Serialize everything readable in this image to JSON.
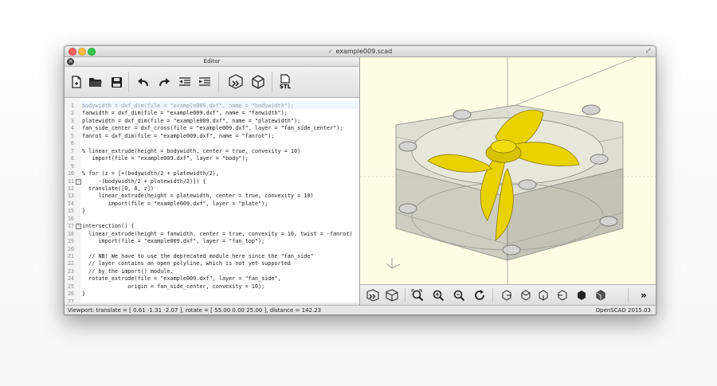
{
  "window": {
    "title": "example009.scad"
  },
  "editor": {
    "title": "Editor",
    "toolbar": [
      {
        "icon": "new-file-icon",
        "label": "New"
      },
      {
        "icon": "open-folder-icon",
        "label": "Open"
      },
      {
        "icon": "save-icon",
        "label": "Save"
      },
      {
        "icon": "undo-icon",
        "label": "Undo"
      },
      {
        "icon": "redo-icon",
        "label": "Redo"
      },
      {
        "icon": "unindent-icon",
        "label": "Unindent"
      },
      {
        "icon": "indent-icon",
        "label": "Indent"
      },
      {
        "icon": "preview-icon",
        "label": "Preview"
      },
      {
        "icon": "render-icon",
        "label": "Render"
      },
      {
        "icon": "export-stl-icon",
        "label": "STL"
      }
    ],
    "lines": [
      {
        "n": "1",
        "fold": "",
        "text": "bodywidth = dxf_dim(file = \"example009.dxf\", name = \"bodywidth\");"
      },
      {
        "n": "2",
        "fold": "",
        "text": "fanwidth = dxf_dim(file = \"example009.dxf\", name = \"fanwidth\");"
      },
      {
        "n": "3",
        "fold": "",
        "text": "platewidth = dxf_dim(file = \"example009.dxf\", name = \"platewidth\");"
      },
      {
        "n": "4",
        "fold": "",
        "text": "fan_side_center = dxf_cross(file = \"example009.dxf\", layer = \"fan_side_center\");"
      },
      {
        "n": "5",
        "fold": "",
        "text": "fanrot = dxf_dim(file = \"example009.dxf\", name = \"fanrot\");"
      },
      {
        "n": "6",
        "fold": "",
        "text": ""
      },
      {
        "n": "7",
        "fold": "",
        "text": "% linear_extrude(height = bodywidth, center = true, convexity = 10)"
      },
      {
        "n": "8",
        "fold": "",
        "text": "   import(file = \"example009.dxf\", layer = \"body\");"
      },
      {
        "n": "9",
        "fold": "",
        "text": ""
      },
      {
        "n": "10",
        "fold": "",
        "text": "% for (z = [+(bodywidth/2 + platewidth/2),"
      },
      {
        "n": "11",
        "fold": "−",
        "text": "     -(bodywidth/2 + platewidth/2)]) {"
      },
      {
        "n": "12",
        "fold": "",
        "text": "  translate([0, 0, z])"
      },
      {
        "n": "13",
        "fold": "",
        "text": "     linear_extrude(height = platewidth, center = true, convexity = 10)"
      },
      {
        "n": "14",
        "fold": "",
        "text": "        import(file = \"example009.dxf\", layer = \"plate\");"
      },
      {
        "n": "15",
        "fold": "",
        "text": "}"
      },
      {
        "n": "16",
        "fold": "",
        "text": ""
      },
      {
        "n": "17",
        "fold": "−",
        "text": "intersection() {"
      },
      {
        "n": "18",
        "fold": "",
        "text": "  linear_extrude(height = fanwidth, center = true, convexity = 10, twist = -fanrot)"
      },
      {
        "n": "19",
        "fold": "",
        "text": "     import(file = \"example009.dxf\", layer = \"fan_top\");"
      },
      {
        "n": "20",
        "fold": "",
        "text": ""
      },
      {
        "n": "21",
        "fold": "",
        "text": "  // NB! We have to use the deprecated module here since the \"fan_side\""
      },
      {
        "n": "22",
        "fold": "",
        "text": "  // layer contains an open polyline, which is not yet supported"
      },
      {
        "n": "23",
        "fold": "",
        "text": "  // by the import() module."
      },
      {
        "n": "24",
        "fold": "",
        "text": "  rotate_extrude(file = \"example009.dxf\", layer = \"fan_side\","
      },
      {
        "n": "25",
        "fold": "",
        "text": "              origin = fan_side_center, convexity = 10);"
      },
      {
        "n": "26",
        "fold": "",
        "text": "}"
      },
      {
        "n": "27",
        "fold": "",
        "text": ""
      }
    ]
  },
  "viewer": {
    "toolbar": [
      {
        "icon": "preview-icon"
      },
      {
        "icon": "render-icon"
      },
      {
        "icon": "view-all-icon"
      },
      {
        "icon": "zoom-in-icon"
      },
      {
        "icon": "zoom-out-icon"
      },
      {
        "icon": "reset-view-icon"
      },
      {
        "icon": "view-right-icon"
      },
      {
        "icon": "view-top-icon"
      },
      {
        "icon": "view-bottom-icon"
      },
      {
        "icon": "view-left-icon"
      },
      {
        "icon": "view-front-icon"
      },
      {
        "icon": "view-back-icon"
      },
      {
        "icon": "more-icon",
        "label": "»"
      }
    ]
  },
  "status": {
    "viewport": "Viewport: translate = [ 0.61 -1.31 -2.07 ], rotate = [ 55.00 0.00 25.00 ], distance = 142.23",
    "version": "OpenSCAD 2015.03"
  },
  "colors": {
    "model_yellow": "#e8d200",
    "viewer_bg": "#fffee5",
    "ghost_gray": "#b9b9b0"
  }
}
